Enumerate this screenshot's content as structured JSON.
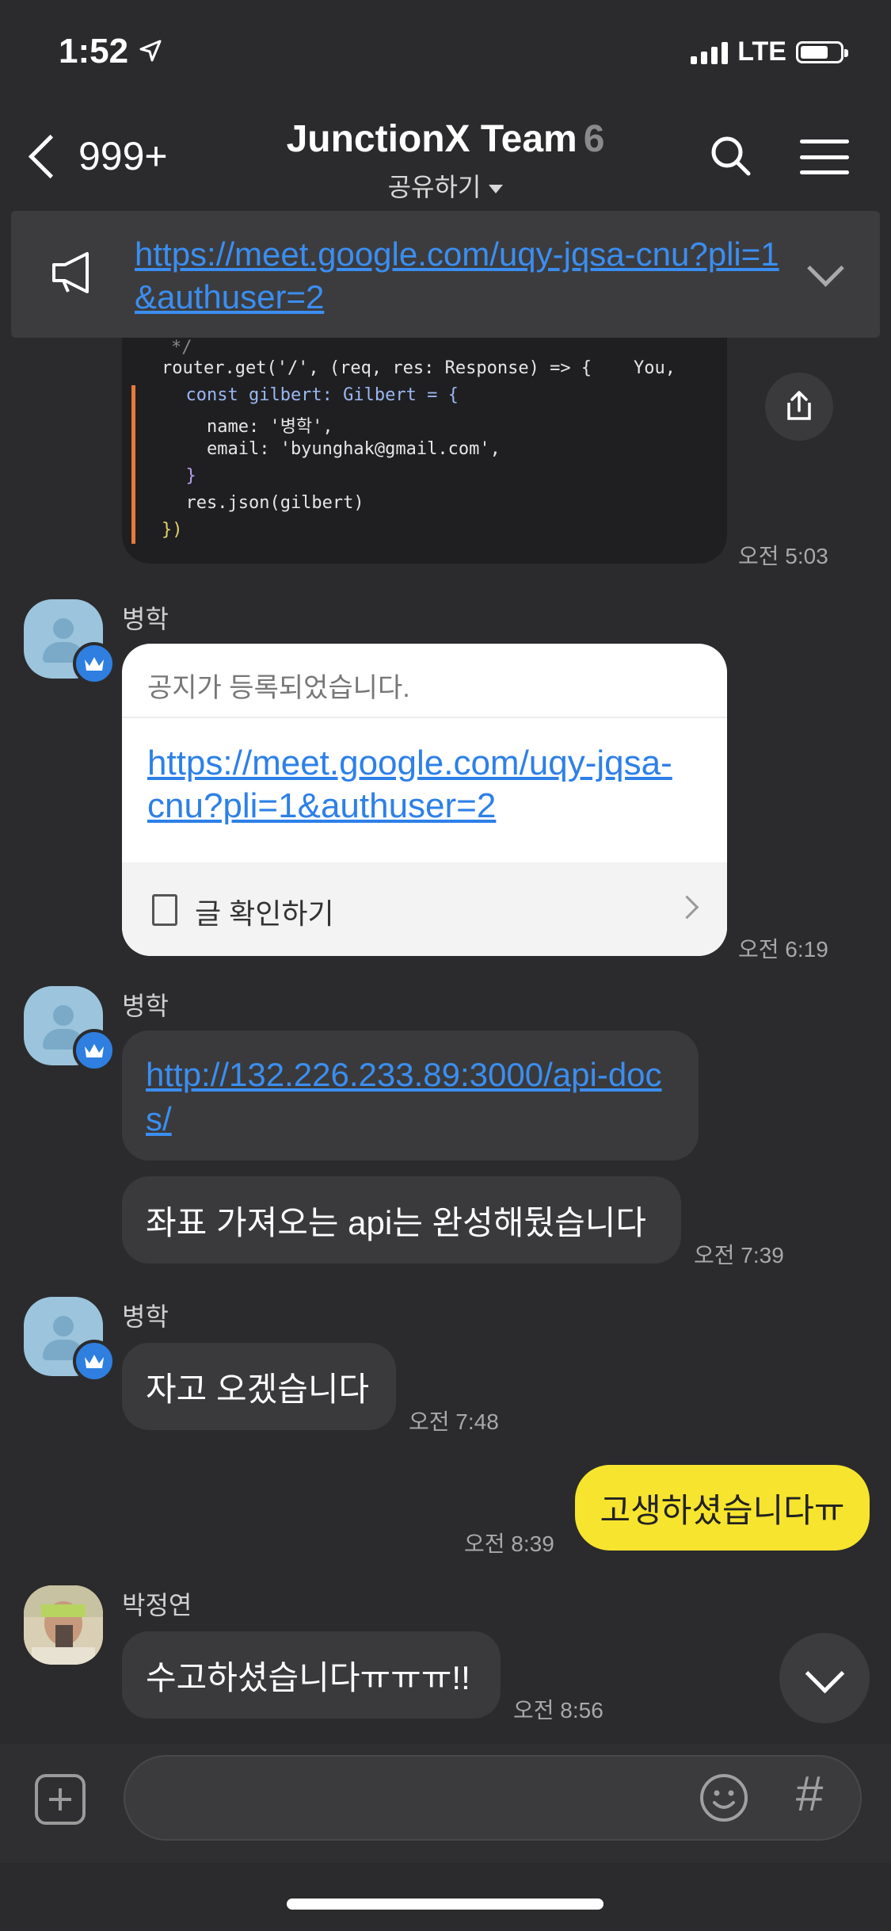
{
  "status_bar": {
    "time": "1:52",
    "network": "LTE"
  },
  "header": {
    "back_count": "999+",
    "title": "JunctionX Team",
    "member_count": "6",
    "share_label": "공유하기"
  },
  "notice_bar": {
    "link": "https://meet.google.com/uqy-jqsa-cnu?pli=1&authuser=2"
  },
  "code_image": {
    "lines": [
      "*/",
      "router.get('/', (req, res: Response) => {    You,",
      "  const gilbert: Gilbert = {",
      "    name: '병학',",
      "    email: 'byunghak@gmail.com',",
      "  }",
      "  res.json(gilbert)",
      "})"
    ],
    "time": "오전 5:03"
  },
  "messages": [
    {
      "sender": "병학",
      "notice_card": {
        "header": "공지가 등록되었습니다.",
        "link": "https://meet.google.com/uqy-jqsa-cnu?pli=1&authuser=2",
        "footer": "글 확인하기"
      },
      "time": "오전 6:19"
    },
    {
      "sender": "병학",
      "link": "http://132.226.233.89:3000/api-docs/",
      "text": "좌표 가져오는 api는 완성해뒀습니다",
      "time": "오전 7:39"
    },
    {
      "sender": "병학",
      "text": "자고 오겠습니다",
      "time": "오전 7:48"
    },
    {
      "mine": true,
      "text": "고생하셨습니다ㅠ",
      "time": "오전 8:39"
    },
    {
      "sender": "박정연",
      "text": "수고하셨습니다ㅠㅠㅠ!!",
      "time": "오전 8:56"
    }
  ],
  "input": {
    "placeholder": ""
  }
}
